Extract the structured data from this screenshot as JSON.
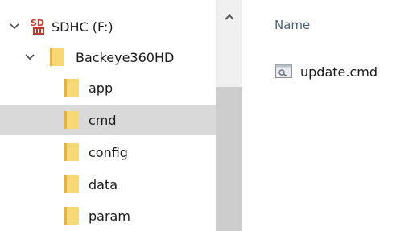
{
  "navigation": {
    "items": [
      {
        "label": "SDHC (F:)",
        "icon": "sd-card-drive-icon",
        "expanded": true
      },
      {
        "label": "Backeye360HD",
        "icon": "folder-icon",
        "expanded": true
      },
      {
        "label": "app",
        "icon": "folder-icon"
      },
      {
        "label": "cmd",
        "icon": "folder-icon",
        "selected": true
      },
      {
        "label": "config",
        "icon": "folder-icon"
      },
      {
        "label": "data",
        "icon": "folder-icon"
      },
      {
        "label": "param",
        "icon": "folder-icon"
      }
    ]
  },
  "content": {
    "column_header": "Name",
    "files": [
      {
        "name": "update.cmd",
        "icon": "command-file-icon"
      }
    ]
  },
  "colors": {
    "selected_row": "#d9d9d9",
    "folder_yellow": "#f8d775",
    "folder_dark": "#e3b34a",
    "header_text": "#4c607a",
    "sd_red": "#c0392b"
  }
}
